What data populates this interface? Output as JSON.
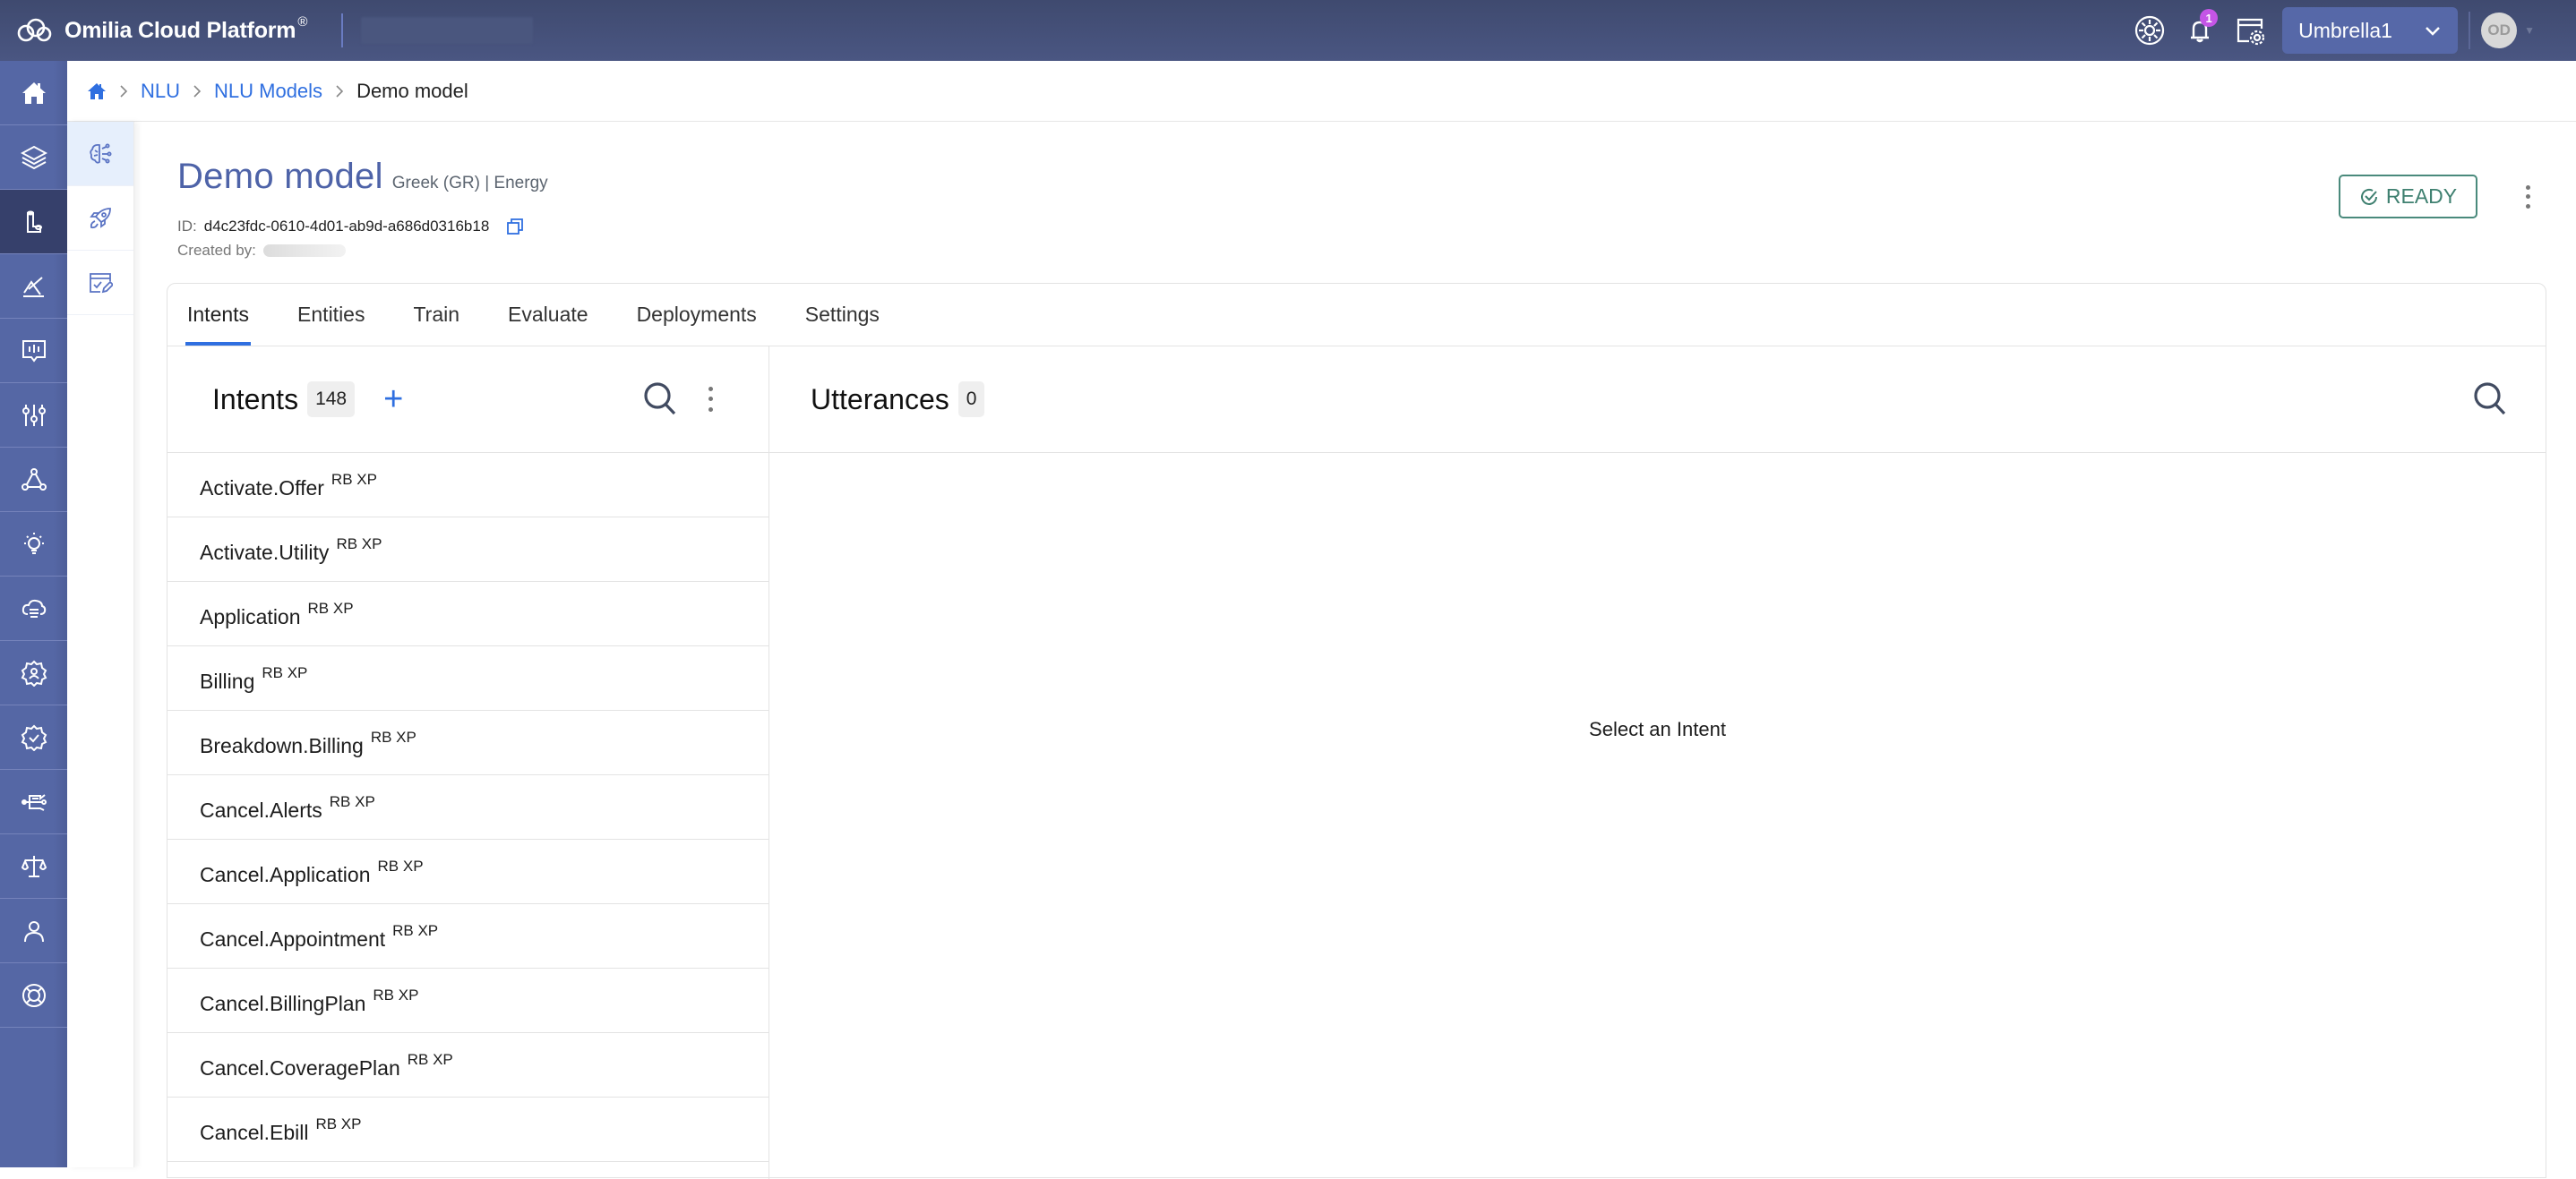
{
  "topbar": {
    "app_name": "Omilia Cloud Platform",
    "app_name_mark": "®",
    "logo_icon": "cloud-logo-icon",
    "icons": [
      "help-wheel-icon",
      "bell-icon",
      "app-settings-icon"
    ],
    "notification_count": "1",
    "workspace": "Umbrella1",
    "user_initials": "OD"
  },
  "sidebar": {
    "items": [
      {
        "icon": "home-icon",
        "active": false
      },
      {
        "icon": "layers-icon",
        "active": false
      },
      {
        "icon": "nlu-blocks-icon",
        "active": true
      },
      {
        "icon": "analytics-icon",
        "active": false
      },
      {
        "icon": "insights-icon",
        "active": false
      },
      {
        "icon": "sliders-icon",
        "active": false
      },
      {
        "icon": "network-icon",
        "active": false
      },
      {
        "icon": "lightbulb-icon",
        "active": false
      },
      {
        "icon": "cloud-storage-icon",
        "active": false
      },
      {
        "icon": "user-settings-icon",
        "active": false
      },
      {
        "icon": "verified-badge-icon",
        "active": false
      },
      {
        "icon": "integrations-icon",
        "active": false
      },
      {
        "icon": "scales-icon",
        "active": false
      },
      {
        "icon": "user-icon",
        "active": false
      },
      {
        "icon": "support-icon",
        "active": false
      }
    ]
  },
  "subsidebar": {
    "items": [
      {
        "icon": "brain-icon",
        "active": true
      },
      {
        "icon": "rocket-icon",
        "active": false
      },
      {
        "icon": "edit-checklist-icon",
        "active": false
      }
    ]
  },
  "breadcrumb": {
    "items": [
      "NLU",
      "NLU Models"
    ],
    "current": "Demo model"
  },
  "model": {
    "title": "Demo model",
    "subtitle": "Greek (GR) | Energy",
    "id_label": "ID:",
    "id_value": "d4c23fdc-0610-4d01-ab9d-a686d0316b18",
    "created_by_label": "Created by:",
    "status": "READY"
  },
  "tabs": [
    {
      "label": "Intents",
      "active": true
    },
    {
      "label": "Entities",
      "active": false
    },
    {
      "label": "Train",
      "active": false
    },
    {
      "label": "Evaluate",
      "active": false
    },
    {
      "label": "Deployments",
      "active": false
    },
    {
      "label": "Settings",
      "active": false
    }
  ],
  "intents_panel": {
    "title": "Intents",
    "count": "148",
    "add_label": "+",
    "items": [
      {
        "name": "Activate.Offer",
        "tag": "RB XP"
      },
      {
        "name": "Activate.Utility",
        "tag": "RB XP"
      },
      {
        "name": "Application",
        "tag": "RB XP"
      },
      {
        "name": "Billing",
        "tag": "RB XP"
      },
      {
        "name": "Breakdown.Billing",
        "tag": "RB XP"
      },
      {
        "name": "Cancel.Alerts",
        "tag": "RB XP"
      },
      {
        "name": "Cancel.Application",
        "tag": "RB XP"
      },
      {
        "name": "Cancel.Appointment",
        "tag": "RB XP"
      },
      {
        "name": "Cancel.BillingPlan",
        "tag": "RB XP"
      },
      {
        "name": "Cancel.CoveragePlan",
        "tag": "RB XP"
      },
      {
        "name": "Cancel.Ebill",
        "tag": "RB XP"
      }
    ]
  },
  "utterances_panel": {
    "title": "Utterances",
    "count": "0",
    "empty_message": "Select an Intent"
  },
  "colors": {
    "accent": "#2f6fe0",
    "sidebar": "#5567a5",
    "sidebar_active": "#36406b",
    "title": "#4e63a8",
    "ready": "#3f8070",
    "badge": "#c455e6"
  }
}
